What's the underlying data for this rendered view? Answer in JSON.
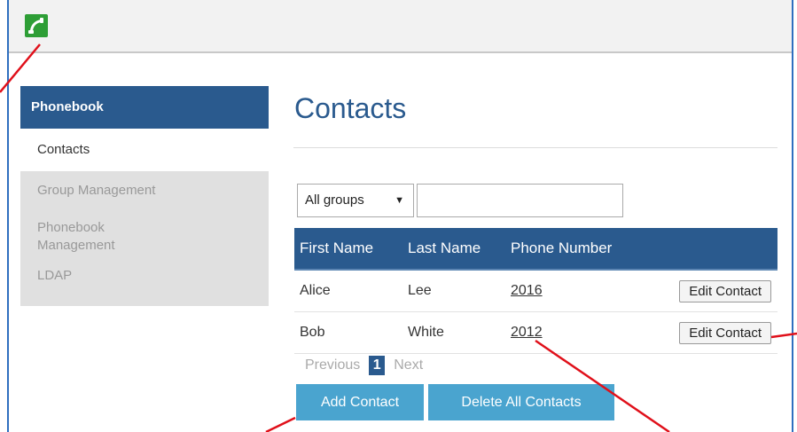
{
  "sidebar": {
    "header": "Phonebook",
    "items": [
      {
        "label": "Contacts",
        "active": true
      },
      {
        "label": "Group Management",
        "active": false
      },
      {
        "label": "Phonebook\nManagement",
        "active": false
      },
      {
        "label": "LDAP",
        "active": false
      }
    ]
  },
  "main": {
    "title": "Contacts",
    "filter": {
      "selected": "All groups",
      "search_value": ""
    },
    "table": {
      "headers": [
        "First Name",
        "Last Name",
        "Phone Number"
      ],
      "rows": [
        {
          "first": "Alice",
          "last": "Lee",
          "phone": "2016",
          "action": "Edit Contact"
        },
        {
          "first": "Bob",
          "last": "White",
          "phone": "2012",
          "action": "Edit Contact"
        }
      ]
    },
    "pagination": {
      "previous": "Previous",
      "current": "1",
      "next": "Next"
    },
    "buttons": {
      "add": "Add Contact",
      "delete_all": "Delete All Contacts"
    }
  },
  "icons": {
    "app": "phone-icon",
    "select_arrow": "caret-down-icon"
  },
  "colors": {
    "primary": "#2a5a8e",
    "button": "#4aa4cf",
    "annotation": "#e0101a",
    "logo": "#2e9e36"
  }
}
